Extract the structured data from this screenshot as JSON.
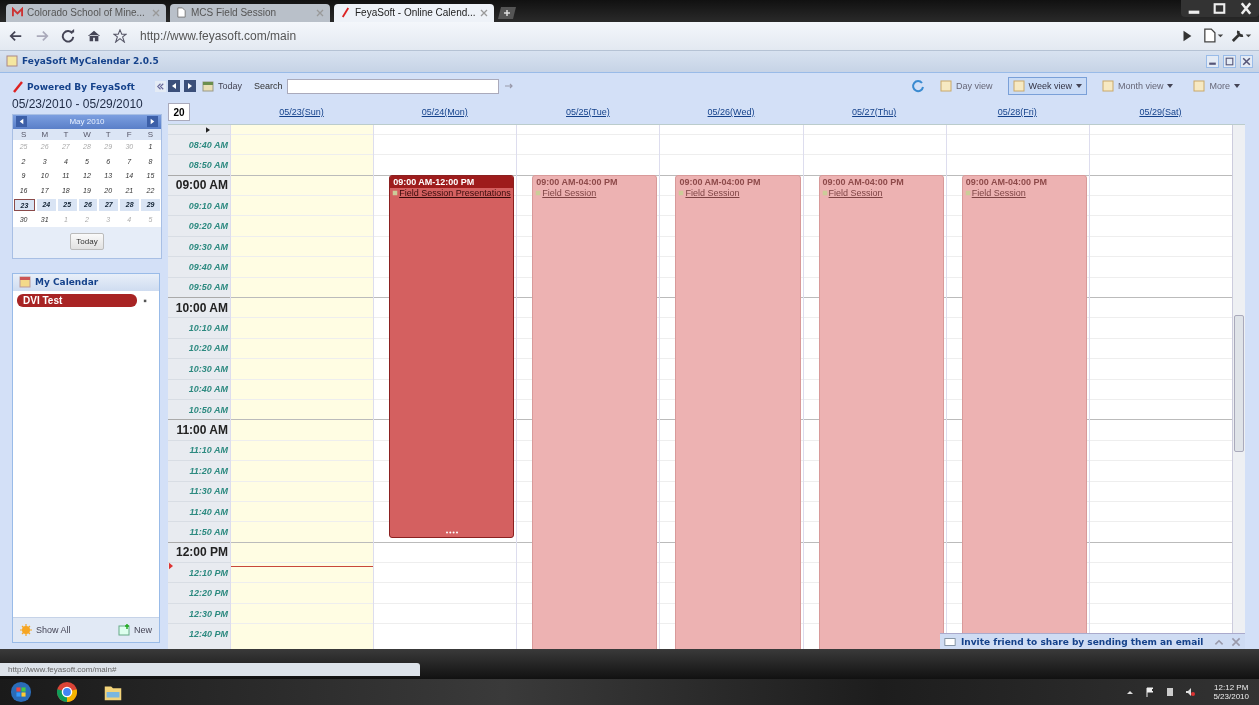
{
  "browser": {
    "tabs": [
      {
        "label": "Colorado School of Mine...",
        "kind": "mail",
        "selected": false
      },
      {
        "label": "MCS Field Session",
        "kind": "page",
        "selected": false
      },
      {
        "label": "FeyaSoft - Online Calend...",
        "kind": "app",
        "selected": true
      }
    ],
    "url": "http://www.feyasoft.com/main",
    "status_url": "http://www.feyasoft.com/main#"
  },
  "app": {
    "title": "FeyaSoft MyCalendar 2.0.5"
  },
  "sidebar": {
    "powered_by": "Powered By FeyaSoft",
    "date_range": "05/23/2010 - 05/29/2010",
    "mini_calendar": {
      "month_label": "May 2010",
      "weekdays": [
        "S",
        "M",
        "T",
        "W",
        "T",
        "F",
        "S"
      ],
      "weeks": [
        {
          "selected": false,
          "days": [
            {
              "d": "25",
              "in_month": false,
              "today": false
            },
            {
              "d": "26",
              "in_month": false,
              "today": false
            },
            {
              "d": "27",
              "in_month": false,
              "today": false
            },
            {
              "d": "28",
              "in_month": false,
              "today": false
            },
            {
              "d": "29",
              "in_month": false,
              "today": false
            },
            {
              "d": "30",
              "in_month": false,
              "today": false
            },
            {
              "d": "1",
              "in_month": true,
              "today": false
            }
          ]
        },
        {
          "selected": false,
          "days": [
            {
              "d": "2",
              "in_month": true,
              "today": false
            },
            {
              "d": "3",
              "in_month": true,
              "today": false
            },
            {
              "d": "4",
              "in_month": true,
              "today": false
            },
            {
              "d": "5",
              "in_month": true,
              "today": false
            },
            {
              "d": "6",
              "in_month": true,
              "today": false
            },
            {
              "d": "7",
              "in_month": true,
              "today": false
            },
            {
              "d": "8",
              "in_month": true,
              "today": false
            }
          ]
        },
        {
          "selected": false,
          "days": [
            {
              "d": "9",
              "in_month": true,
              "today": false
            },
            {
              "d": "10",
              "in_month": true,
              "today": false
            },
            {
              "d": "11",
              "in_month": true,
              "today": false
            },
            {
              "d": "12",
              "in_month": true,
              "today": false
            },
            {
              "d": "13",
              "in_month": true,
              "today": false
            },
            {
              "d": "14",
              "in_month": true,
              "today": false
            },
            {
              "d": "15",
              "in_month": true,
              "today": false
            }
          ]
        },
        {
          "selected": false,
          "days": [
            {
              "d": "16",
              "in_month": true,
              "today": false
            },
            {
              "d": "17",
              "in_month": true,
              "today": false
            },
            {
              "d": "18",
              "in_month": true,
              "today": false
            },
            {
              "d": "19",
              "in_month": true,
              "today": false
            },
            {
              "d": "20",
              "in_month": true,
              "today": false
            },
            {
              "d": "21",
              "in_month": true,
              "today": false
            },
            {
              "d": "22",
              "in_month": true,
              "today": false
            }
          ]
        },
        {
          "selected": true,
          "days": [
            {
              "d": "23",
              "in_month": true,
              "today": true
            },
            {
              "d": "24",
              "in_month": true,
              "today": false
            },
            {
              "d": "25",
              "in_month": true,
              "today": false
            },
            {
              "d": "26",
              "in_month": true,
              "today": false
            },
            {
              "d": "27",
              "in_month": true,
              "today": false
            },
            {
              "d": "28",
              "in_month": true,
              "today": false
            },
            {
              "d": "29",
              "in_month": true,
              "today": false
            }
          ]
        },
        {
          "selected": false,
          "days": [
            {
              "d": "30",
              "in_month": true,
              "today": false
            },
            {
              "d": "31",
              "in_month": true,
              "today": false
            },
            {
              "d": "1",
              "in_month": false,
              "today": false
            },
            {
              "d": "2",
              "in_month": false,
              "today": false
            },
            {
              "d": "3",
              "in_month": false,
              "today": false
            },
            {
              "d": "4",
              "in_month": false,
              "today": false
            },
            {
              "d": "5",
              "in_month": false,
              "today": false
            }
          ]
        }
      ],
      "today_button": "Today"
    },
    "my_calendar": {
      "title": "My Calendar",
      "items": [
        {
          "name": "DVI Test",
          "color": "#a82424"
        }
      ]
    },
    "footer": {
      "show_all": "Show All",
      "new": "New"
    }
  },
  "toolbar": {
    "today": "Today",
    "search_label": "Search",
    "views": [
      {
        "label": "Day view",
        "menu": false,
        "selected": false
      },
      {
        "label": "Week view",
        "menu": true,
        "selected": true
      },
      {
        "label": "Month view",
        "menu": true,
        "selected": false
      },
      {
        "label": "More",
        "menu": true,
        "selected": false
      }
    ]
  },
  "week_number": "20",
  "time_slots": [
    {
      "label": "08:40 AM",
      "kind": "minor"
    },
    {
      "label": "08:50 AM",
      "kind": "minor"
    },
    {
      "label": "09:00 AM",
      "kind": "hour"
    },
    {
      "label": "09:10 AM",
      "kind": "minor"
    },
    {
      "label": "09:20 AM",
      "kind": "minor"
    },
    {
      "label": "09:30 AM",
      "kind": "minor"
    },
    {
      "label": "09:40 AM",
      "kind": "minor"
    },
    {
      "label": "09:50 AM",
      "kind": "minor"
    },
    {
      "label": "10:00 AM",
      "kind": "hour"
    },
    {
      "label": "10:10 AM",
      "kind": "minor"
    },
    {
      "label": "10:20 AM",
      "kind": "minor"
    },
    {
      "label": "10:30 AM",
      "kind": "minor"
    },
    {
      "label": "10:40 AM",
      "kind": "minor"
    },
    {
      "label": "10:50 AM",
      "kind": "minor"
    },
    {
      "label": "11:00 AM",
      "kind": "hour"
    },
    {
      "label": "11:10 AM",
      "kind": "minor"
    },
    {
      "label": "11:20 AM",
      "kind": "minor"
    },
    {
      "label": "11:30 AM",
      "kind": "minor"
    },
    {
      "label": "11:40 AM",
      "kind": "minor"
    },
    {
      "label": "11:50 AM",
      "kind": "minor"
    },
    {
      "label": "12:00 PM",
      "kind": "hour"
    },
    {
      "label": "12:10 PM",
      "kind": "minor"
    },
    {
      "label": "12:20 PM",
      "kind": "minor"
    },
    {
      "label": "12:30 PM",
      "kind": "minor"
    },
    {
      "label": "12:40 PM",
      "kind": "minor"
    }
  ],
  "days": [
    {
      "label": "05/23(Sun)",
      "today": true
    },
    {
      "label": "05/24(Mon)",
      "today": false,
      "events": [
        {
          "time": "09:00 AM-12:00 PM",
          "title": "Field Session Presentations",
          "kind": "active"
        }
      ]
    },
    {
      "label": "05/25(Tue)",
      "today": false,
      "events": [
        {
          "time": "09:00 AM-04:00 PM",
          "title": "Field Session",
          "kind": "faded"
        }
      ]
    },
    {
      "label": "05/26(Wed)",
      "today": false,
      "events": [
        {
          "time": "09:00 AM-04:00 PM",
          "title": "Field Session",
          "kind": "faded"
        }
      ]
    },
    {
      "label": "05/27(Thu)",
      "today": false,
      "events": [
        {
          "time": "09:00 AM-04:00 PM",
          "title": "Field Session",
          "kind": "faded"
        }
      ]
    },
    {
      "label": "05/28(Fri)",
      "today": false,
      "events": [
        {
          "time": "09:00 AM-04:00 PM",
          "title": "Field Session",
          "kind": "faded"
        }
      ]
    },
    {
      "label": "05/29(Sat)",
      "today": false
    }
  ],
  "invite": {
    "text": "Invite friend to share by sending them an email"
  },
  "taskbar": {
    "time": "12:12 PM",
    "date": "5/23/2010"
  }
}
